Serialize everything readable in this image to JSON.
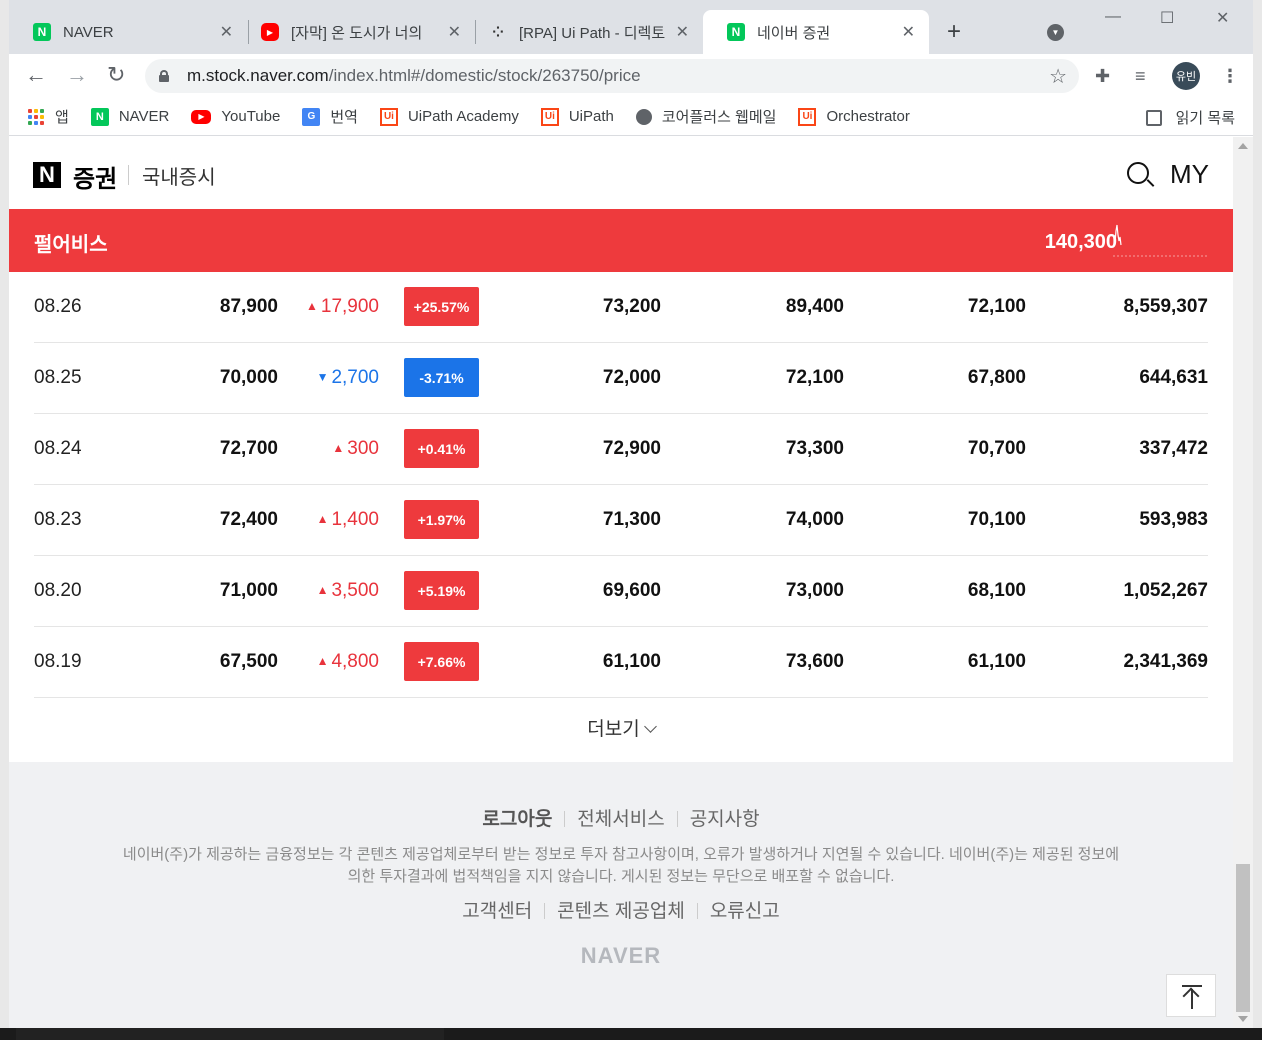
{
  "browser": {
    "tabs": [
      {
        "title": "NAVER",
        "favicon": "naver-icon"
      },
      {
        "title": "[자막] 온 도시가 너의",
        "favicon": "youtube-icon"
      },
      {
        "title": "[RPA] Ui Path - 디렉토",
        "favicon": "tistory-icon"
      },
      {
        "title": "네이버 증권",
        "favicon": "naver-icon"
      }
    ],
    "url_host": "m.stock.naver.com",
    "url_path": "/index.html#/domestic/stock/263750/price",
    "profile_label": "유빈",
    "bookmarks": [
      {
        "label": "앱",
        "icon": "apps-icon"
      },
      {
        "label": "NAVER",
        "icon": "naver-icon"
      },
      {
        "label": "YouTube",
        "icon": "youtube-icon"
      },
      {
        "label": "번역",
        "icon": "translate-icon"
      },
      {
        "label": "UiPath Academy",
        "icon": "uipath-icon"
      },
      {
        "label": "UiPath",
        "icon": "uipath-icon"
      },
      {
        "label": "코어플러스 웹메일",
        "icon": "globe-icon"
      },
      {
        "label": "Orchestrator",
        "icon": "uipath-icon"
      }
    ],
    "reading_list": "읽기 목록"
  },
  "site": {
    "logo_letter": "N",
    "logo_text": "증권",
    "section": "국내증시",
    "my_label": "MY"
  },
  "stock": {
    "name": "펄어비스",
    "price": "140,300"
  },
  "prices": [
    {
      "date": "08.26",
      "close": "87,900",
      "change": "17,900",
      "dir": "up",
      "pct": "+25.57%",
      "open": "73,200",
      "high": "89,400",
      "low": "72,100",
      "volume": "8,559,307"
    },
    {
      "date": "08.25",
      "close": "70,000",
      "change": "2,700",
      "dir": "down",
      "pct": "-3.71%",
      "open": "72,000",
      "high": "72,100",
      "low": "67,800",
      "volume": "644,631"
    },
    {
      "date": "08.24",
      "close": "72,700",
      "change": "300",
      "dir": "up",
      "pct": "+0.41%",
      "open": "72,900",
      "high": "73,300",
      "low": "70,700",
      "volume": "337,472"
    },
    {
      "date": "08.23",
      "close": "72,400",
      "change": "1,400",
      "dir": "up",
      "pct": "+1.97%",
      "open": "71,300",
      "high": "74,000",
      "low": "70,100",
      "volume": "593,983"
    },
    {
      "date": "08.20",
      "close": "71,000",
      "change": "3,500",
      "dir": "up",
      "pct": "+5.19%",
      "open": "69,600",
      "high": "73,000",
      "low": "68,100",
      "volume": "1,052,267"
    },
    {
      "date": "08.19",
      "close": "67,500",
      "change": "4,800",
      "dir": "up",
      "pct": "+7.66%",
      "open": "61,100",
      "high": "73,600",
      "low": "61,100",
      "volume": "2,341,369"
    }
  ],
  "more_label": "더보기",
  "footer": {
    "links": [
      "로그아웃",
      "전체서비스",
      "공지사항"
    ],
    "notice_line1": "네이버(주)가 제공하는 금융정보는 각 콘텐츠 제공업체로부터 받는 정보로 투자 참고사항이며, 오류가 발생하거나 지연될 수 있습니다. 네이버(주)는 제공된 정보에",
    "notice_line2": "의한 투자결과에 법적책임을 지지 않습니다. 게시된 정보는 무단으로 배포할 수 없습니다.",
    "links2": [
      "고객센터",
      "콘텐츠 제공업체",
      "오류신고"
    ],
    "brand": "NAVER"
  },
  "colors": {
    "up": "#ee3a3d",
    "down": "#1b74e8",
    "stock_bar": "#ee3a3d"
  }
}
